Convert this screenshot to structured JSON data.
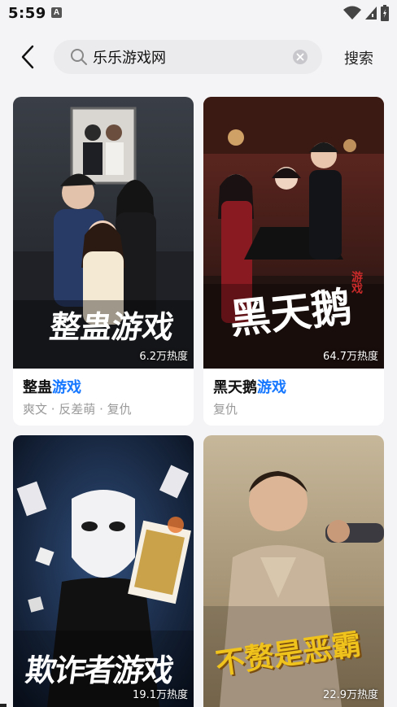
{
  "status": {
    "time": "5:59",
    "app_icon_letter": "A"
  },
  "search": {
    "query": "乐乐游戏网",
    "button_label": "搜索"
  },
  "colors": {
    "keyword_highlight": "#1677ff",
    "background": "#f4f4f6"
  },
  "cards": [
    {
      "title_prefix": "整蛊",
      "title_keyword": "游戏",
      "tags": "爽文 · 反差萌 · 复仇",
      "heat": "6.2万热度",
      "poster_text": "整蛊游戏"
    },
    {
      "title_prefix": "黑天鹅",
      "title_keyword": "游戏",
      "tags": "复仇",
      "heat": "64.7万热度",
      "poster_text": "黑天鹅",
      "poster_sub": "游戏"
    },
    {
      "heat": "19.1万热度",
      "poster_text": "欺诈者游戏"
    },
    {
      "heat": "22.9万热度",
      "poster_text": "不赘是恶霸"
    }
  ]
}
